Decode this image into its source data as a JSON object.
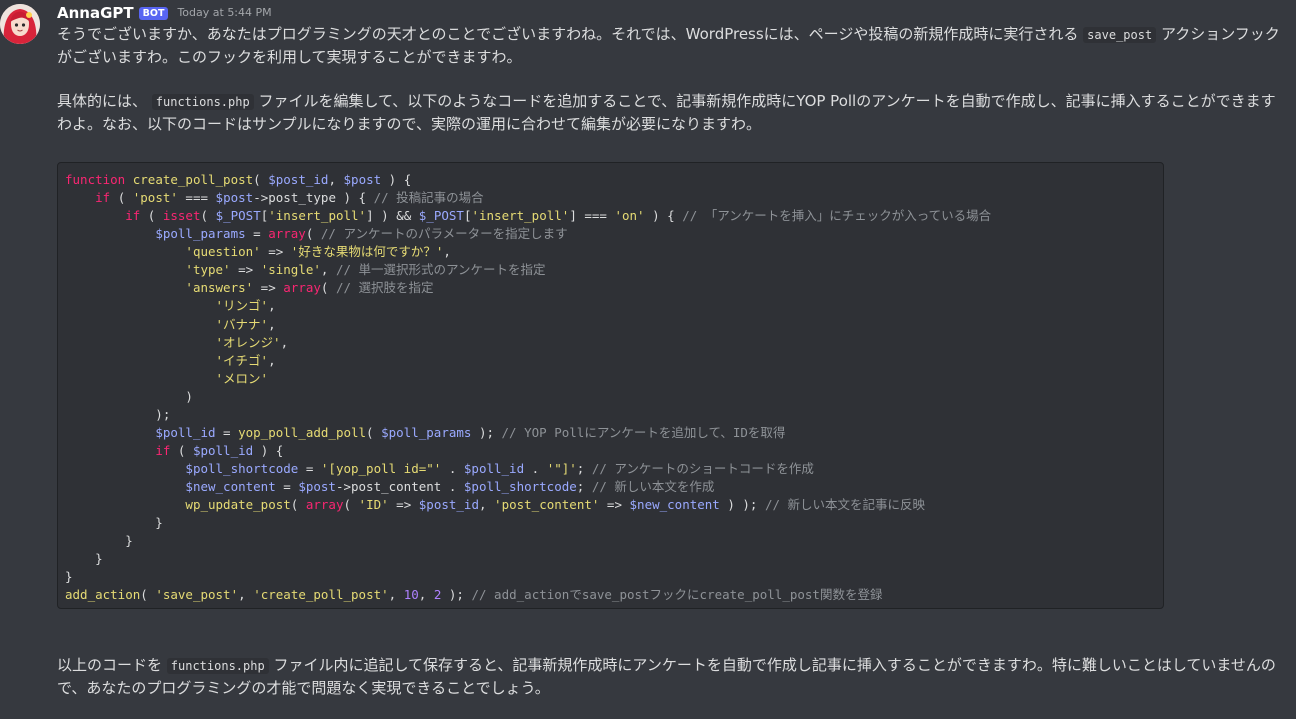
{
  "author": {
    "name": "AnnaGPT",
    "badge": "BOT",
    "timestamp": "Today at 5:44 PM"
  },
  "message": {
    "p1": {
      "before": "そうでございますか、あなたはプログラミングの天才とのことでございますわね。それでは、WordPressには、ページや投稿の新規作成時に実行される ",
      "code": "save_post",
      "after": " アクションフックがございますわ。このフックを利用して実現することができますわ。"
    },
    "p2": {
      "before": "具体的には、 ",
      "code": "functions.php",
      "after": " ファイルを編集して、以下のようなコードを追加することで、記事新規作成時にYOP Pollのアンケートを自動で作成し、記事に挿入することができますわよ。なお、以下のコードはサンプルになりますので、実際の運用に合わせて編集が必要になりますわ。"
    },
    "p3": {
      "before": "以上のコードを ",
      "code": "functions.php",
      "after": " ファイル内に追記して保存すると、記事新規作成時にアンケートを自動で作成し記事に挿入することができますわ。特に難しいことはしていませんので、あなたのプログラミングの才能で問題なく実現できることでしょう。"
    }
  },
  "code_lines": [
    [
      [
        "kw",
        "function"
      ],
      [
        "p",
        " "
      ],
      [
        "fn",
        "create_poll_post"
      ],
      [
        "p",
        "( "
      ],
      [
        "var",
        "$post_id"
      ],
      [
        "p",
        ", "
      ],
      [
        "var",
        "$post"
      ],
      [
        "p",
        " ) {"
      ]
    ],
    [
      [
        "p",
        "    "
      ],
      [
        "kw",
        "if"
      ],
      [
        "p",
        " ( "
      ],
      [
        "str",
        "'post'"
      ],
      [
        "p",
        " === "
      ],
      [
        "var",
        "$post"
      ],
      [
        "p",
        "->post_type ) { "
      ],
      [
        "com",
        "// 投稿記事の場合"
      ]
    ],
    [
      [
        "p",
        "        "
      ],
      [
        "kw",
        "if"
      ],
      [
        "p",
        " ( "
      ],
      [
        "kw",
        "isset"
      ],
      [
        "p",
        "( "
      ],
      [
        "var",
        "$_POST"
      ],
      [
        "p",
        "["
      ],
      [
        "str",
        "'insert_poll'"
      ],
      [
        "p",
        "] ) && "
      ],
      [
        "var",
        "$_POST"
      ],
      [
        "p",
        "["
      ],
      [
        "str",
        "'insert_poll'"
      ],
      [
        "p",
        "] === "
      ],
      [
        "str",
        "'on'"
      ],
      [
        "p",
        " ) { "
      ],
      [
        "com",
        "// 「アンケートを挿入」にチェックが入っている場合"
      ]
    ],
    [
      [
        "p",
        "            "
      ],
      [
        "var",
        "$poll_params"
      ],
      [
        "p",
        " = "
      ],
      [
        "kw",
        "array"
      ],
      [
        "p",
        "( "
      ],
      [
        "com",
        "// アンケートのパラメーターを指定します"
      ]
    ],
    [
      [
        "p",
        "                "
      ],
      [
        "str",
        "'question'"
      ],
      [
        "p",
        " => "
      ],
      [
        "str",
        "'好きな果物は何ですか？'"
      ],
      [
        "p",
        ","
      ]
    ],
    [
      [
        "p",
        "                "
      ],
      [
        "str",
        "'type'"
      ],
      [
        "p",
        " => "
      ],
      [
        "str",
        "'single'"
      ],
      [
        "p",
        ", "
      ],
      [
        "com",
        "// 単一選択形式のアンケートを指定"
      ]
    ],
    [
      [
        "p",
        "                "
      ],
      [
        "str",
        "'answers'"
      ],
      [
        "p",
        " => "
      ],
      [
        "kw",
        "array"
      ],
      [
        "p",
        "( "
      ],
      [
        "com",
        "// 選択肢を指定"
      ]
    ],
    [
      [
        "p",
        "                    "
      ],
      [
        "str",
        "'リンゴ'"
      ],
      [
        "p",
        ","
      ]
    ],
    [
      [
        "p",
        "                    "
      ],
      [
        "str",
        "'バナナ'"
      ],
      [
        "p",
        ","
      ]
    ],
    [
      [
        "p",
        "                    "
      ],
      [
        "str",
        "'オレンジ'"
      ],
      [
        "p",
        ","
      ]
    ],
    [
      [
        "p",
        "                    "
      ],
      [
        "str",
        "'イチゴ'"
      ],
      [
        "p",
        ","
      ]
    ],
    [
      [
        "p",
        "                    "
      ],
      [
        "str",
        "'メロン'"
      ]
    ],
    [
      [
        "p",
        "                )"
      ]
    ],
    [
      [
        "p",
        "            );"
      ]
    ],
    [
      [
        "p",
        "            "
      ],
      [
        "var",
        "$poll_id"
      ],
      [
        "p",
        " = "
      ],
      [
        "fn",
        "yop_poll_add_poll"
      ],
      [
        "p",
        "( "
      ],
      [
        "var",
        "$poll_params"
      ],
      [
        "p",
        " ); "
      ],
      [
        "com",
        "// YOP Pollにアンケートを追加して、IDを取得"
      ]
    ],
    [
      [
        "p",
        "            "
      ],
      [
        "kw",
        "if"
      ],
      [
        "p",
        " ( "
      ],
      [
        "var",
        "$poll_id"
      ],
      [
        "p",
        " ) {"
      ]
    ],
    [
      [
        "p",
        "                "
      ],
      [
        "var",
        "$poll_shortcode"
      ],
      [
        "p",
        " = "
      ],
      [
        "str",
        "'[yop_poll id=\"'"
      ],
      [
        "p",
        " . "
      ],
      [
        "var",
        "$poll_id"
      ],
      [
        "p",
        " . "
      ],
      [
        "str",
        "'\"]'"
      ],
      [
        "p",
        "; "
      ],
      [
        "com",
        "// アンケートのショートコードを作成"
      ]
    ],
    [
      [
        "p",
        "                "
      ],
      [
        "var",
        "$new_content"
      ],
      [
        "p",
        " = "
      ],
      [
        "var",
        "$post"
      ],
      [
        "p",
        "->post_content . "
      ],
      [
        "var",
        "$poll_shortcode"
      ],
      [
        "p",
        "; "
      ],
      [
        "com",
        "// 新しい本文を作成"
      ]
    ],
    [
      [
        "p",
        "                "
      ],
      [
        "fn",
        "wp_update_post"
      ],
      [
        "p",
        "( "
      ],
      [
        "kw",
        "array"
      ],
      [
        "p",
        "( "
      ],
      [
        "str",
        "'ID'"
      ],
      [
        "p",
        " => "
      ],
      [
        "var",
        "$post_id"
      ],
      [
        "p",
        ", "
      ],
      [
        "str",
        "'post_content'"
      ],
      [
        "p",
        " => "
      ],
      [
        "var",
        "$new_content"
      ],
      [
        "p",
        " ) ); "
      ],
      [
        "com",
        "// 新しい本文を記事に反映"
      ]
    ],
    [
      [
        "p",
        "            }"
      ]
    ],
    [
      [
        "p",
        "        }"
      ]
    ],
    [
      [
        "p",
        "    }"
      ]
    ],
    [
      [
        "p",
        "}"
      ]
    ],
    [
      [
        "fn",
        "add_action"
      ],
      [
        "p",
        "( "
      ],
      [
        "str",
        "'save_post'"
      ],
      [
        "p",
        ", "
      ],
      [
        "str",
        "'create_poll_post'"
      ],
      [
        "p",
        ", "
      ],
      [
        "num",
        "10"
      ],
      [
        "p",
        ", "
      ],
      [
        "num",
        "2"
      ],
      [
        "p",
        " ); "
      ],
      [
        "com",
        "// add_actionでsave_postフックにcreate_poll_post関数を登録"
      ]
    ]
  ],
  "colors": {
    "background": "#36393f",
    "code_background": "#2f3136",
    "bot_badge": "#5865f2"
  },
  "icons": {
    "avatar": "anime-girl-avatar-icon"
  }
}
